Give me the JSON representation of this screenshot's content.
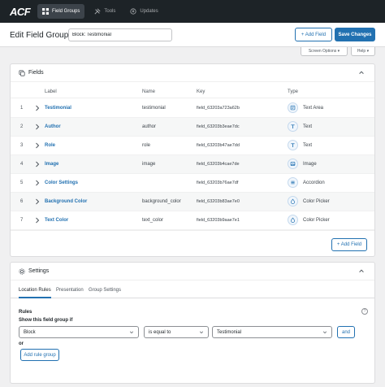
{
  "app": {
    "logo": "ACF",
    "nav": [
      {
        "label": "Field Groups",
        "icon": "grid-icon",
        "active": true
      },
      {
        "label": "Tools",
        "icon": "tools-icon",
        "active": false
      },
      {
        "label": "Updates",
        "icon": "updates-icon",
        "active": false
      }
    ]
  },
  "header": {
    "title": "Edit Field Group",
    "group_title_value": "Block: Testimonial",
    "add_field_label": "+ Add Field",
    "save_label": "Save Changes"
  },
  "screen_options": "Screen Options ▾",
  "help": "Help ▾",
  "fields": {
    "title": "Fields",
    "columns": [
      "Label",
      "Name",
      "Key",
      "Type"
    ],
    "rows": [
      {
        "order": "1",
        "label": "Testimonial",
        "name": "testimonial",
        "key": "field_63203a723a62b",
        "type": "Text Area",
        "icon": "textarea-icon"
      },
      {
        "order": "2",
        "label": "Author",
        "name": "author",
        "key": "field_63203b3eae7dc",
        "type": "Text",
        "icon": "text-icon"
      },
      {
        "order": "3",
        "label": "Role",
        "name": "role",
        "key": "field_63203b47ae7dd",
        "type": "Text",
        "icon": "text-icon"
      },
      {
        "order": "4",
        "label": "Image",
        "name": "image",
        "key": "field_63203b4cae7de",
        "type": "Image",
        "icon": "image-icon"
      },
      {
        "order": "5",
        "label": "Color Settings",
        "name": "",
        "key": "field_63203b76ae7df",
        "type": "Accordion",
        "icon": "accordion-icon"
      },
      {
        "order": "6",
        "label": "Background Color",
        "name": "background_color",
        "key": "field_63203b83ae7e0",
        "type": "Color Picker",
        "icon": "color-picker-icon"
      },
      {
        "order": "7",
        "label": "Text Color",
        "name": "text_color",
        "key": "field_63203b9aae7e1",
        "type": "Color Picker",
        "icon": "color-picker-icon"
      }
    ],
    "add_field_label": "+ Add Field"
  },
  "settings": {
    "title": "Settings",
    "tabs": [
      "Location Rules",
      "Presentation",
      "Group Settings"
    ],
    "rules_label": "Rules",
    "show_label": "Show this field group if",
    "param": "Block",
    "operator": "is equal to",
    "value": "Testimonial",
    "and_label": "and",
    "or_label": "or",
    "add_rule_group_label": "Add rule group",
    "help_glyph": "?"
  },
  "colors": {
    "primary": "#2271b1",
    "topbar": "#1d2327"
  }
}
